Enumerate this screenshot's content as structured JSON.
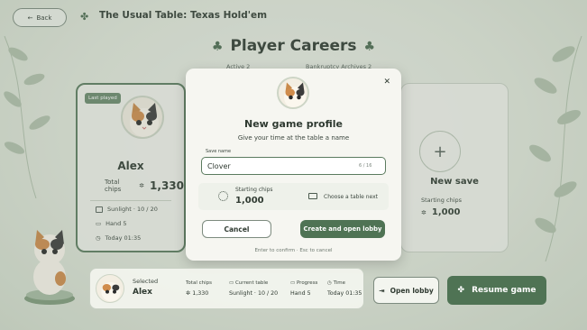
{
  "header": {
    "back_label": "Back",
    "title": "The Usual Table: Texas Hold'em"
  },
  "page": {
    "title": "Player Careers",
    "tab_active": "Active 2",
    "tab_archived": "Bankruptcy Archives 2"
  },
  "cards": {
    "alex": {
      "badge": "Last played",
      "name": "Alex",
      "chips_label": "Total chips",
      "chips_value": "1,330",
      "table": "Sunlight · 10 / 20",
      "hand": "Hand 5",
      "time": "Today 01:35"
    },
    "new_save": {
      "title": "New save",
      "chips_label": "Starting chips",
      "chips_value": "1,000"
    }
  },
  "modal": {
    "title": "New game profile",
    "subtitle": "Give your time at the table a name",
    "field_label": "Save name",
    "input_value": "Clover",
    "char_count": "6 / 16",
    "starting_chips_label": "Starting chips",
    "starting_chips_value": "1,000",
    "choose_table": "Choose a table next",
    "cancel_label": "Cancel",
    "create_label": "Create and open lobby",
    "hint": "Enter to confirm · Esc to cancel"
  },
  "bottom_bar": {
    "selected_label": "Selected",
    "selected_name": "Alex",
    "total_chips_label": "Total chips",
    "total_chips_value": "1,330",
    "current_table_label": "Current table",
    "current_table_value": "Sunlight · 10 / 20",
    "progress_label": "Progress",
    "progress_value": "Hand 5",
    "time_label": "Time",
    "time_value": "Today 01:35"
  },
  "actions": {
    "open_lobby": "Open lobby",
    "resume_game": "Resume game"
  },
  "colors": {
    "accent": "#4f7354",
    "background": "#dfe5d9"
  }
}
